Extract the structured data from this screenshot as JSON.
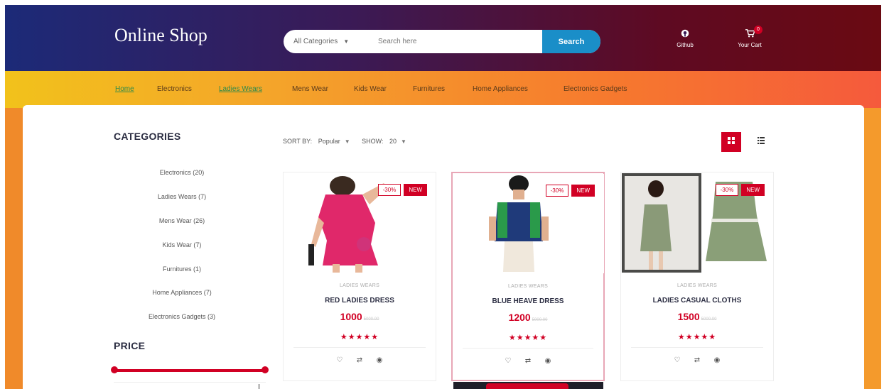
{
  "header": {
    "brand": "Online Shop",
    "search": {
      "category": "All Categories",
      "placeholder": "Search here",
      "button": "Search"
    },
    "github_label": "Github",
    "cart_label": "Your Cart",
    "cart_count": "0"
  },
  "nav": {
    "items": [
      "Home",
      "Electronics",
      "Ladies Wears",
      "Mens Wear",
      "Kids Wear",
      "Furnitures",
      "Home Appliances",
      "Electronics Gadgets"
    ]
  },
  "aside": {
    "categories_title": "CATEGORIES",
    "categories": [
      "Electronics (20)",
      "Ladies Wears (7)",
      "Mens Wear (26)",
      "Kids Wear (7)",
      "Furnitures (1)",
      "Home Appliances (7)",
      "Electronics Gadgets (3)"
    ],
    "price_title": "PRICE"
  },
  "store": {
    "sort_label": "SORT BY:",
    "sort_value": "Popular",
    "show_label": "SHOW:",
    "show_value": "20"
  },
  "products": [
    {
      "category": "LADIES WEARS",
      "name": "RED LADIES DRESS",
      "price": "1000",
      "old_price": "5000.00",
      "sale": "-30%",
      "new": "NEW",
      "rating": "★★★★★"
    },
    {
      "category": "LADIES WEARS",
      "name": "BLUE HEAVE DRESS",
      "price": "1200",
      "old_price": "5000.00",
      "sale": "-30%",
      "new": "NEW",
      "rating": "★★★★★"
    },
    {
      "category": "LADIES WEARS",
      "name": "LADIES CASUAL CLOTHS",
      "price": "1500",
      "old_price": "5000.00",
      "sale": "-30%",
      "new": "NEW",
      "rating": "★★★★★"
    }
  ],
  "icons": {
    "github": "github-icon",
    "cart": "shopping-cart-icon",
    "grid": "grid-view-icon",
    "list": "list-view-icon",
    "wishlist": "heart-icon",
    "compare": "exchange-icon",
    "quickview": "eye-icon"
  },
  "colors": {
    "accent": "#d10024",
    "search_button": "#1a8ec8",
    "header_start": "#1c2a78",
    "header_end": "#6a0a12",
    "nav_start": "#f2c21b",
    "nav_end": "#f55a3c"
  }
}
